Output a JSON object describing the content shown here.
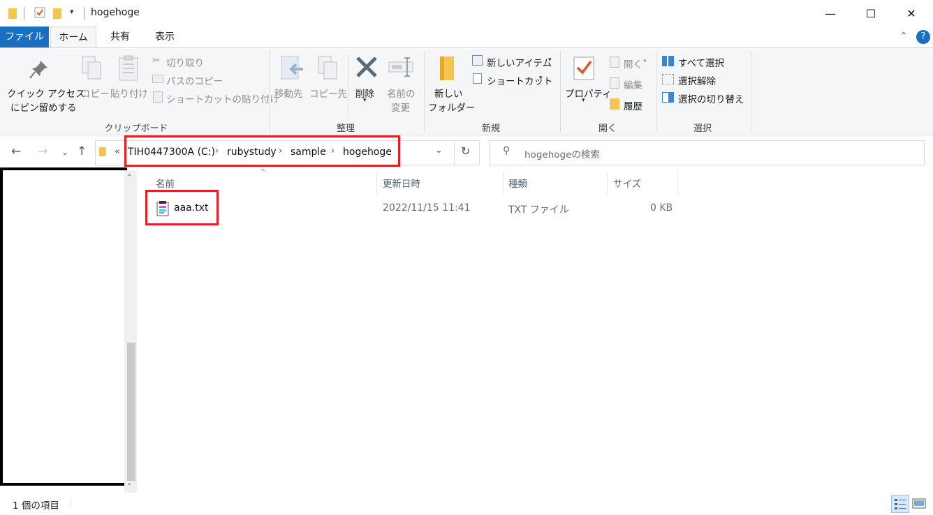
{
  "window": {
    "title": "hogehoge",
    "minimize_glyph": "—",
    "maximize_glyph": "☐",
    "close_glyph": "✕"
  },
  "tabs": {
    "file": "ファイル",
    "home": "ホーム",
    "share": "共有",
    "view": "表示"
  },
  "ribbon": {
    "clipboard": {
      "label": "クリップボード",
      "pin_line1": "クイック アクセス",
      "pin_line2": "にピン留めする",
      "copy": "コピー",
      "paste": "貼り付け",
      "cut": "切り取り",
      "copy_path": "パスのコピー",
      "paste_shortcut": "ショートカットの貼り付け"
    },
    "organize": {
      "label": "整理",
      "move_to": "移動先",
      "copy_to": "コピー先",
      "delete": "削除",
      "rename_line1": "名前の",
      "rename_line2": "変更"
    },
    "new": {
      "label": "新規",
      "new_folder_line1": "新しい",
      "new_folder_line2": "フォルダー",
      "new_item": "新しいアイテム",
      "shortcut": "ショートカット"
    },
    "open": {
      "label": "開く",
      "properties": "プロパティ",
      "open": "開く",
      "edit": "編集",
      "history": "履歴"
    },
    "select": {
      "label": "選択",
      "select_all": "すべて選択",
      "select_none": "選択解除",
      "invert": "選択の切り替え"
    }
  },
  "address": {
    "overflow": "«",
    "crumbs": [
      "TIH0447300A (C:)",
      "rubystudy",
      "sample",
      "hogehoge"
    ],
    "search_placeholder": "hogehogeの検索"
  },
  "columns": {
    "name": "名前",
    "modified": "更新日時",
    "type": "種類",
    "size": "サイズ"
  },
  "files": [
    {
      "name": "aaa.txt",
      "modified": "2022/11/15 11:41",
      "type": "TXT ファイル",
      "size": "0 KB"
    }
  ],
  "status": {
    "count": "1 個の項目"
  },
  "colors": {
    "accent": "#1a6fc1",
    "highlight_box": "#e01f26",
    "folder": "#f6c451"
  }
}
